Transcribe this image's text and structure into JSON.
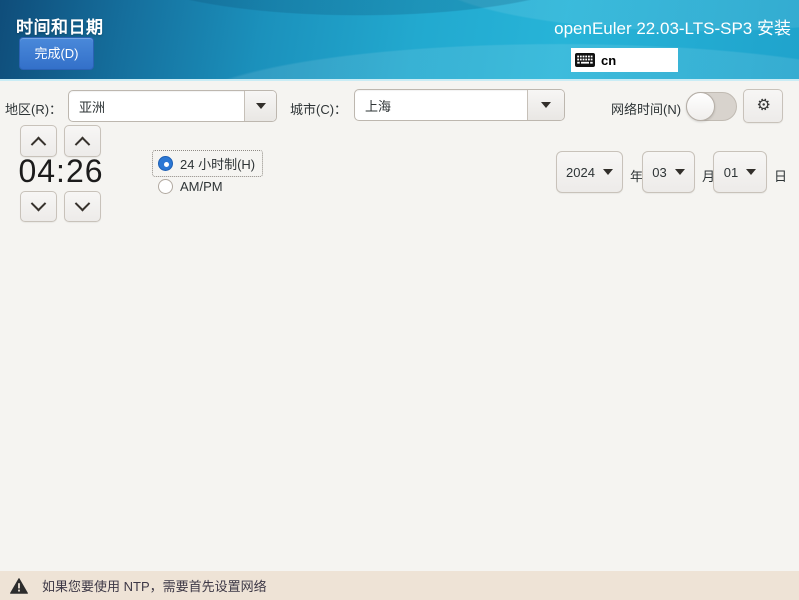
{
  "header": {
    "title": "时间和日期",
    "done_button": "完成(D)",
    "distro": "openEuler 22.03-LTS-SP3 安装",
    "keyboard_layout": "cn"
  },
  "region_bar": {
    "region_label": "地区(R)：",
    "region_value": "亚洲",
    "city_label": "城市(C)：",
    "city_value": "上海",
    "network_time_label": "网络时间(N)",
    "network_time_on": false
  },
  "time": {
    "hours": "04",
    "separator": ":",
    "minutes": "26",
    "format_24h_label": "24 小时制(H)",
    "format_ampm_label": "AM/PM",
    "selected_format": "24h"
  },
  "date": {
    "year_value": "2024",
    "year_suffix": "年",
    "month_value": "03",
    "month_suffix": "月",
    "day_value": "01",
    "day_suffix": "日"
  },
  "footer": {
    "warning_text": "如果您要使用 NTP，需要首先设置网络"
  },
  "icons": {
    "keyboard": "⌨",
    "gear": "⚙",
    "warning": "⚠",
    "dropdown_arrow": "▼",
    "chevron_up": "^",
    "chevron_down": "v"
  },
  "colors": {
    "accent_blue": "#2b77d4",
    "done_button": "#3c7ad1",
    "banner_gradient_start": "#0f4d7a",
    "banner_gradient_end": "#27b4d8",
    "warning_bar_bg": "#eee3d6",
    "content_bg": "#f5f4f1"
  }
}
